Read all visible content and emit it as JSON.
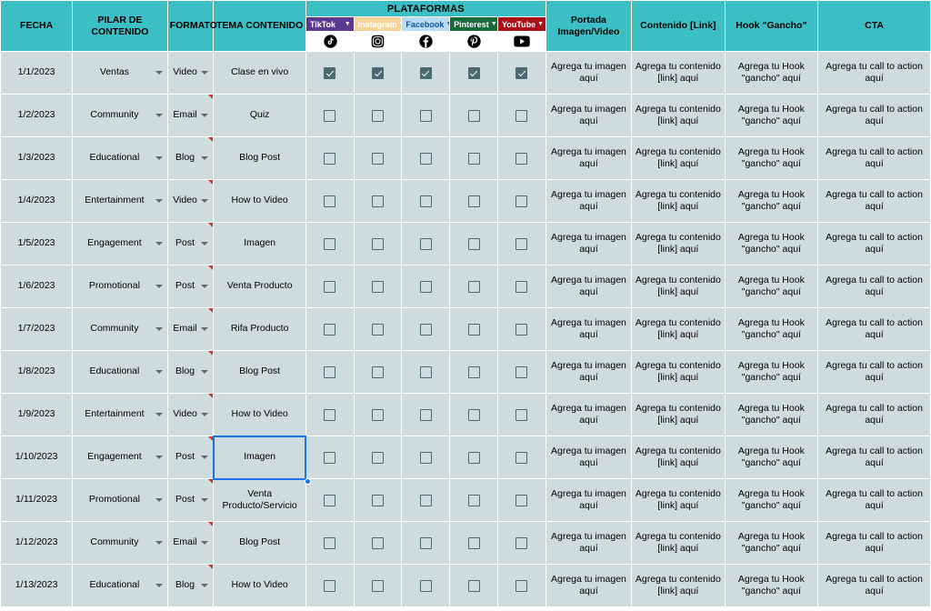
{
  "header": {
    "plataformas_label": "PLATAFORMAS",
    "columns": {
      "fecha": "FECHA",
      "pilar": "PILAR DE CONTENIDO",
      "formato": "FORMATO",
      "tema": "TEMA CONTENIDO",
      "portada": "Portada Imagen/Video",
      "contenido": "Contenido [Link]",
      "hook": "Hook \"Gancho\"",
      "cta": "CTA"
    }
  },
  "platforms": [
    {
      "name": "TikTok",
      "icon": "tiktok-icon",
      "bg": "#5b3a8e",
      "fg": "#ffffff",
      "caret": "#ffffff"
    },
    {
      "name": "Instagram",
      "icon": "instagram-icon",
      "bg": "#f5d49a",
      "fg": "#ffffff",
      "caret": "#ffffff"
    },
    {
      "name": "Facebook",
      "icon": "facebook-icon",
      "bg": "#b9dcf2",
      "fg": "#1457a0",
      "caret": "#1457a0"
    },
    {
      "name": "Pinterest",
      "icon": "pinterest-icon",
      "bg": "#176b3a",
      "fg": "#ffffff",
      "caret": "#ffffff"
    },
    {
      "name": "YouTube",
      "icon": "youtube-icon",
      "bg": "#ab1018",
      "fg": "#ffffff",
      "caret": "#ffffff"
    }
  ],
  "placeholders": {
    "portada": "Agrega tu imagen aquí",
    "contenido": "Agrega tu contenido [link] aquí",
    "hook": "Agrega tu Hook \"gancho\" aquí",
    "cta": "Agrega tu call to action aquí"
  },
  "selection": {
    "cell_text": "Imagen",
    "row_index": 9,
    "column": "tema"
  },
  "colors": {
    "header_teal": "#3bbfc4",
    "cell_bg": "#cfdcdd",
    "gridline": "#ffffff",
    "checkbox": "#4a6a70",
    "selection": "#1a73e8",
    "note_flag": "#d92b2b"
  },
  "rows": [
    {
      "fecha": "1/1/2023",
      "pilar": "Ventas",
      "formato": "Video",
      "tema": "Clase en vivo",
      "checks": [
        true,
        true,
        true,
        true,
        true
      ],
      "note": false
    },
    {
      "fecha": "1/2/2023",
      "pilar": "Community",
      "formato": "Email",
      "tema": "Quiz",
      "checks": [
        false,
        false,
        false,
        false,
        false
      ],
      "note": true
    },
    {
      "fecha": "1/3/2023",
      "pilar": "Educational",
      "formato": "Blog",
      "tema": "Blog Post",
      "checks": [
        false,
        false,
        false,
        false,
        false
      ],
      "note": true
    },
    {
      "fecha": "1/4/2023",
      "pilar": "Entertainment",
      "formato": "Video",
      "tema": "How to Video",
      "checks": [
        false,
        false,
        false,
        false,
        false
      ],
      "note": true
    },
    {
      "fecha": "1/5/2023",
      "pilar": "Engagement",
      "formato": "Post",
      "tema": "Imagen",
      "checks": [
        false,
        false,
        false,
        false,
        false
      ],
      "note": true
    },
    {
      "fecha": "1/6/2023",
      "pilar": "Promotional",
      "formato": "Post",
      "tema": "Venta Producto",
      "checks": [
        false,
        false,
        false,
        false,
        false
      ],
      "note": true
    },
    {
      "fecha": "1/7/2023",
      "pilar": "Community",
      "formato": "Email",
      "tema": "Rifa Producto",
      "checks": [
        false,
        false,
        false,
        false,
        false
      ],
      "note": true
    },
    {
      "fecha": "1/8/2023",
      "pilar": "Educational",
      "formato": "Blog",
      "tema": "Blog Post",
      "checks": [
        false,
        false,
        false,
        false,
        false
      ],
      "note": true
    },
    {
      "fecha": "1/9/2023",
      "pilar": "Entertainment",
      "formato": "Video",
      "tema": "How to Video",
      "checks": [
        false,
        false,
        false,
        false,
        false
      ],
      "note": true
    },
    {
      "fecha": "1/10/2023",
      "pilar": "Engagement",
      "formato": "Post",
      "tema": "Imagen",
      "checks": [
        false,
        false,
        false,
        false,
        false
      ],
      "note": true
    },
    {
      "fecha": "1/11/2023",
      "pilar": "Promotional",
      "formato": "Post",
      "tema": "Venta Producto/Servicio",
      "checks": [
        false,
        false,
        false,
        false,
        false
      ],
      "note": true
    },
    {
      "fecha": "1/12/2023",
      "pilar": "Community",
      "formato": "Email",
      "tema": "Blog Post",
      "checks": [
        false,
        false,
        false,
        false,
        false
      ],
      "note": true
    },
    {
      "fecha": "1/13/2023",
      "pilar": "Educational",
      "formato": "Blog",
      "tema": "How to Video",
      "checks": [
        false,
        false,
        false,
        false,
        false
      ],
      "note": true
    }
  ]
}
